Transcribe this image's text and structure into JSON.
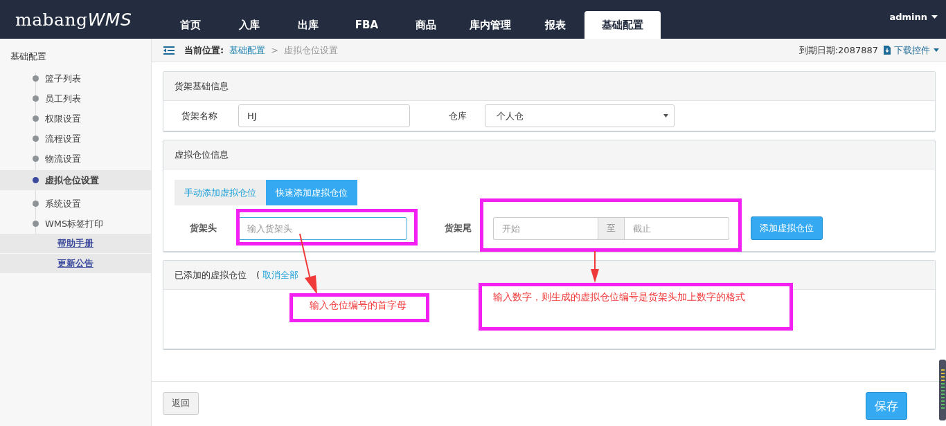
{
  "header": {
    "logo": "mabang",
    "logo_suffix": "WMS",
    "nav": [
      {
        "label": "首页",
        "selected": false
      },
      {
        "label": "入库",
        "selected": false
      },
      {
        "label": "出库",
        "selected": false
      },
      {
        "label": "FBA",
        "selected": false
      },
      {
        "label": "商品",
        "selected": false
      },
      {
        "label": "库内管理",
        "selected": false
      },
      {
        "label": "报表",
        "selected": false
      },
      {
        "label": "基础配置",
        "selected": true
      }
    ],
    "user": "adminn"
  },
  "breadcrumb": {
    "label": "当前位置:",
    "link": "基础配置",
    "separator": ">",
    "current": "虚拟仓位设置",
    "expiry": "到期日期:2087887",
    "download": "下载控件"
  },
  "sidebar": {
    "title": "基础配置",
    "items": [
      {
        "label": "篮子列表",
        "selected": false
      },
      {
        "label": "员工列表",
        "selected": false
      },
      {
        "label": "权限设置",
        "selected": false
      },
      {
        "label": "流程设置",
        "selected": false
      },
      {
        "label": "物流设置",
        "selected": false
      },
      {
        "label": "虚拟仓位设置",
        "selected": true
      },
      {
        "label": "系统设置",
        "selected": false
      },
      {
        "label": "WMS标签打印",
        "selected": false
      }
    ],
    "links": [
      "帮助手册",
      "更新公告"
    ]
  },
  "shelf_info": {
    "title": "货架基础信息",
    "name_label": "货架名称",
    "name_value": "HJ",
    "warehouse_label": "仓库",
    "warehouse_value": "个人仓"
  },
  "virtual_info": {
    "title": "虚拟仓位信息",
    "tabs": [
      {
        "label": "手动添加虚拟仓位",
        "selected": false
      },
      {
        "label": "快速添加虚拟仓位",
        "selected": true
      }
    ],
    "head_label": "货架头",
    "head_placeholder": "输入货架头",
    "tail_label": "货架尾",
    "start_placeholder": "开始",
    "range_separator": "至",
    "end_placeholder": "截止",
    "add_button": "添加虚拟仓位"
  },
  "added": {
    "title": "已添加的虚拟仓位",
    "paren": "(",
    "cancel_all": "取消全部"
  },
  "annotations": [
    "输入仓位编号的首字母",
    "输入数字，则生成的虚拟仓位编号是货架头加上数字的格式"
  ],
  "footer": {
    "back": "返回",
    "save": "保存"
  }
}
